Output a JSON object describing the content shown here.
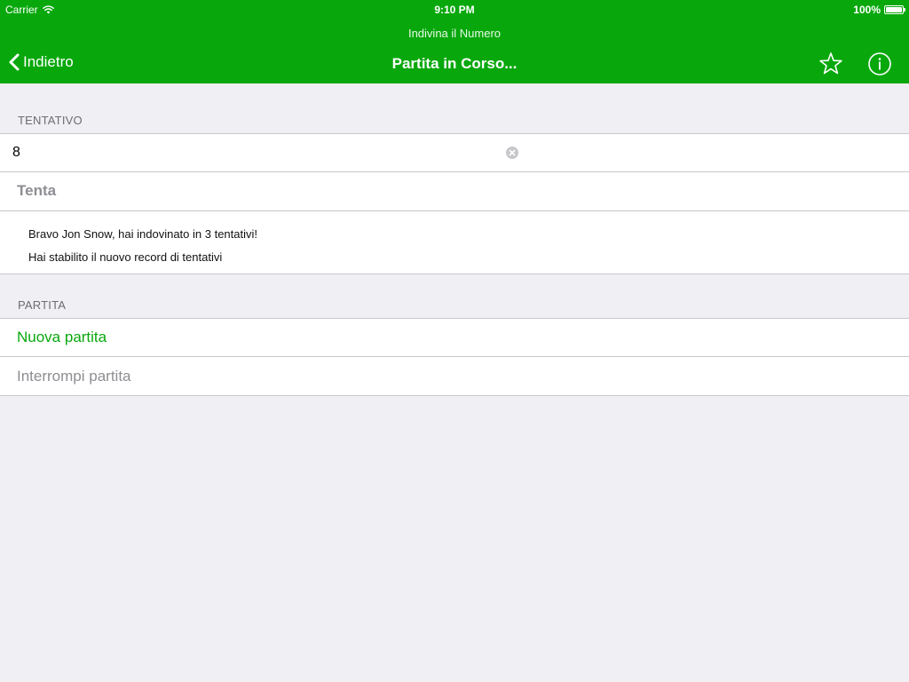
{
  "colors": {
    "accent": "#08a80c",
    "background": "#efeff4",
    "separator": "#c8c7cc",
    "disabled_text": "#8e8e93"
  },
  "status_bar": {
    "carrier": "Carrier",
    "wifi_icon": "wifi-icon",
    "time": "9:10 PM",
    "battery_percent": "100%",
    "battery_icon": "battery-icon",
    "battery_level": 1.0
  },
  "app": {
    "name": "Indivina il Numero"
  },
  "nav_bar": {
    "back_label": "Indietro",
    "back_icon": "chevron-left-icon",
    "title": "Partita in Corso...",
    "star_icon": "star-icon",
    "info_icon": "info-icon"
  },
  "guess_section": {
    "header": "TENTATIVO",
    "input_value": "8",
    "clear_icon": "clear-icon",
    "try_label": "Tenta",
    "messages": [
      "Bravo Jon Snow, hai indovinato in 3 tentativi!",
      "Hai stabilito il nuovo record di tentativi"
    ]
  },
  "game_section": {
    "header": "PARTITA",
    "new_game_label": "Nuova partita",
    "stop_game_label": "Interrompi partita"
  }
}
